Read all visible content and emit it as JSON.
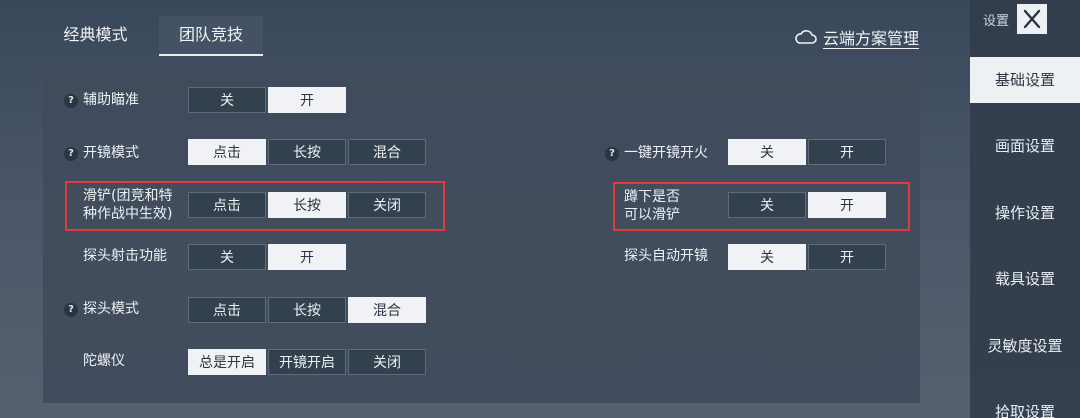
{
  "tabs": [
    {
      "label": "经典模式"
    },
    {
      "label": "团队竞技"
    }
  ],
  "cloud": {
    "label": "云端方案管理"
  },
  "help_mark": "?",
  "rows": {
    "assist_aim": {
      "label": "辅助瞄准",
      "options": [
        "关",
        "开"
      ],
      "selected": "开"
    },
    "scope_mode": {
      "label": "开镜模式",
      "options": [
        "点击",
        "长按",
        "混合"
      ],
      "selected": "点击"
    },
    "slide": {
      "label_line1": "滑铲(团竞和特",
      "label_line2": "种作战中生效)",
      "options": [
        "点击",
        "长按",
        "关闭"
      ],
      "selected": "长按"
    },
    "peek_fire": {
      "label": "探头射击功能",
      "options": [
        "关",
        "开"
      ],
      "selected": "开"
    },
    "peek_mode": {
      "label": "探头模式",
      "options": [
        "点击",
        "长按",
        "混合"
      ],
      "selected": "混合"
    },
    "gyro": {
      "label": "陀螺仪",
      "options": [
        "总是开启",
        "开镜开启",
        "关闭"
      ],
      "selected": "总是开启"
    },
    "one_key_fire": {
      "label": "一键开镜开火",
      "options": [
        "关",
        "开"
      ],
      "selected": "关"
    },
    "crouch_slide": {
      "label_line1": "蹲下是否",
      "label_line2": "可以滑铲",
      "options": [
        "关",
        "开"
      ],
      "selected": "开"
    },
    "peek_auto_scope": {
      "label": "探头自动开镜",
      "options": [
        "关",
        "开"
      ],
      "selected": "关"
    }
  },
  "sidebar": {
    "title": "设置",
    "items": [
      {
        "label": "基础设置"
      },
      {
        "label": "画面设置"
      },
      {
        "label": "操作设置"
      },
      {
        "label": "载具设置"
      },
      {
        "label": "灵敏度设置"
      },
      {
        "label": "拾取设置"
      }
    ]
  },
  "colors": {
    "highlight_box": "#e03a3a",
    "selected_option": "#f0f2f5"
  }
}
